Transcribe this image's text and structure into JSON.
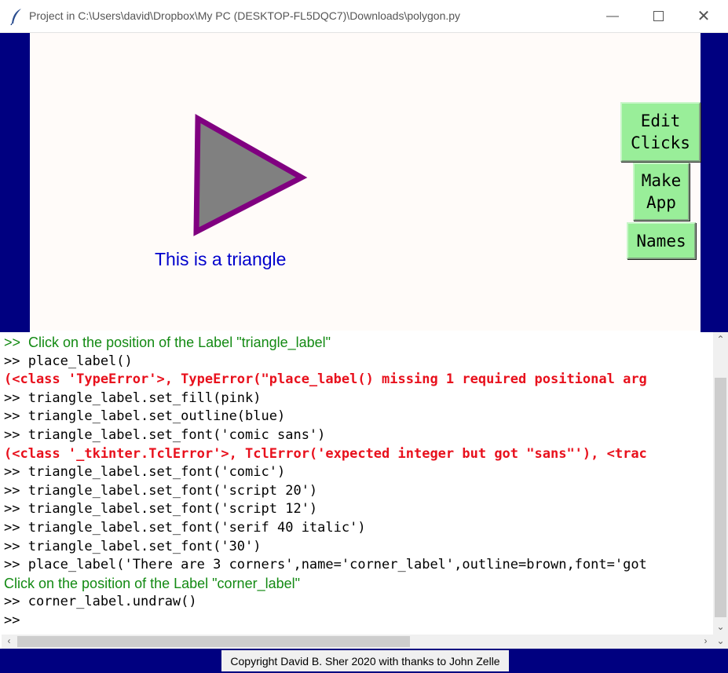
{
  "window": {
    "title": "Project in C:\\Users\\david\\Dropbox\\My PC (DESKTOP-FL5DQC7)\\Downloads\\polygon.py",
    "minimize_icon": "minimize-icon",
    "maximize_icon": "maximize-icon",
    "close_icon": "close-icon",
    "app_icon": "feather-icon"
  },
  "colors": {
    "frame": "#000080",
    "canvas": "#fffbf9",
    "button": "#99ee99",
    "triangle_fill": "#808080",
    "triangle_outline": "#800080",
    "label": "#0000cc",
    "error": "#e8101c",
    "message": "#138a13"
  },
  "canvas": {
    "triangle_label": "This is a triangle"
  },
  "buttons": {
    "edit_clicks": "Edit\nClicks",
    "make_app": "Make\nApp",
    "names": "Names"
  },
  "console": {
    "lines": [
      {
        "type": "msg",
        "text": ">>  Click on the position of the Label \"triangle_label\""
      },
      {
        "type": "code",
        "text": ">> place_label()"
      },
      {
        "type": "err",
        "text": "(<class 'TypeError'>, TypeError(\"place_label() missing 1 required positional arg"
      },
      {
        "type": "code",
        "text": ">> triangle_label.set_fill(pink)"
      },
      {
        "type": "code",
        "text": ">> triangle_label.set_outline(blue)"
      },
      {
        "type": "code",
        "text": ">> triangle_label.set_font('comic sans')"
      },
      {
        "type": "err",
        "text": "(<class '_tkinter.TclError'>, TclError('expected integer but got \"sans\"'), <trac"
      },
      {
        "type": "code",
        "text": ">> triangle_label.set_font('comic')"
      },
      {
        "type": "code",
        "text": ">> triangle_label.set_font('script 20')"
      },
      {
        "type": "code",
        "text": ">> triangle_label.set_font('script 12')"
      },
      {
        "type": "code",
        "text": ">> triangle_label.set_font('serif 40 italic')"
      },
      {
        "type": "code",
        "text": ">> triangle_label.set_font('30')"
      },
      {
        "type": "code",
        "text": ">> place_label('There are 3 corners',name='corner_label',outline=brown,font='got"
      },
      {
        "type": "msg",
        "text": "Click on the position of the Label \"corner_label\""
      },
      {
        "type": "code",
        "text": ">> corner_label.undraw()"
      },
      {
        "type": "code",
        "text": ">>"
      }
    ]
  },
  "status": {
    "copyright": "Copyright David B. Sher 2020 with thanks to John Zelle"
  }
}
